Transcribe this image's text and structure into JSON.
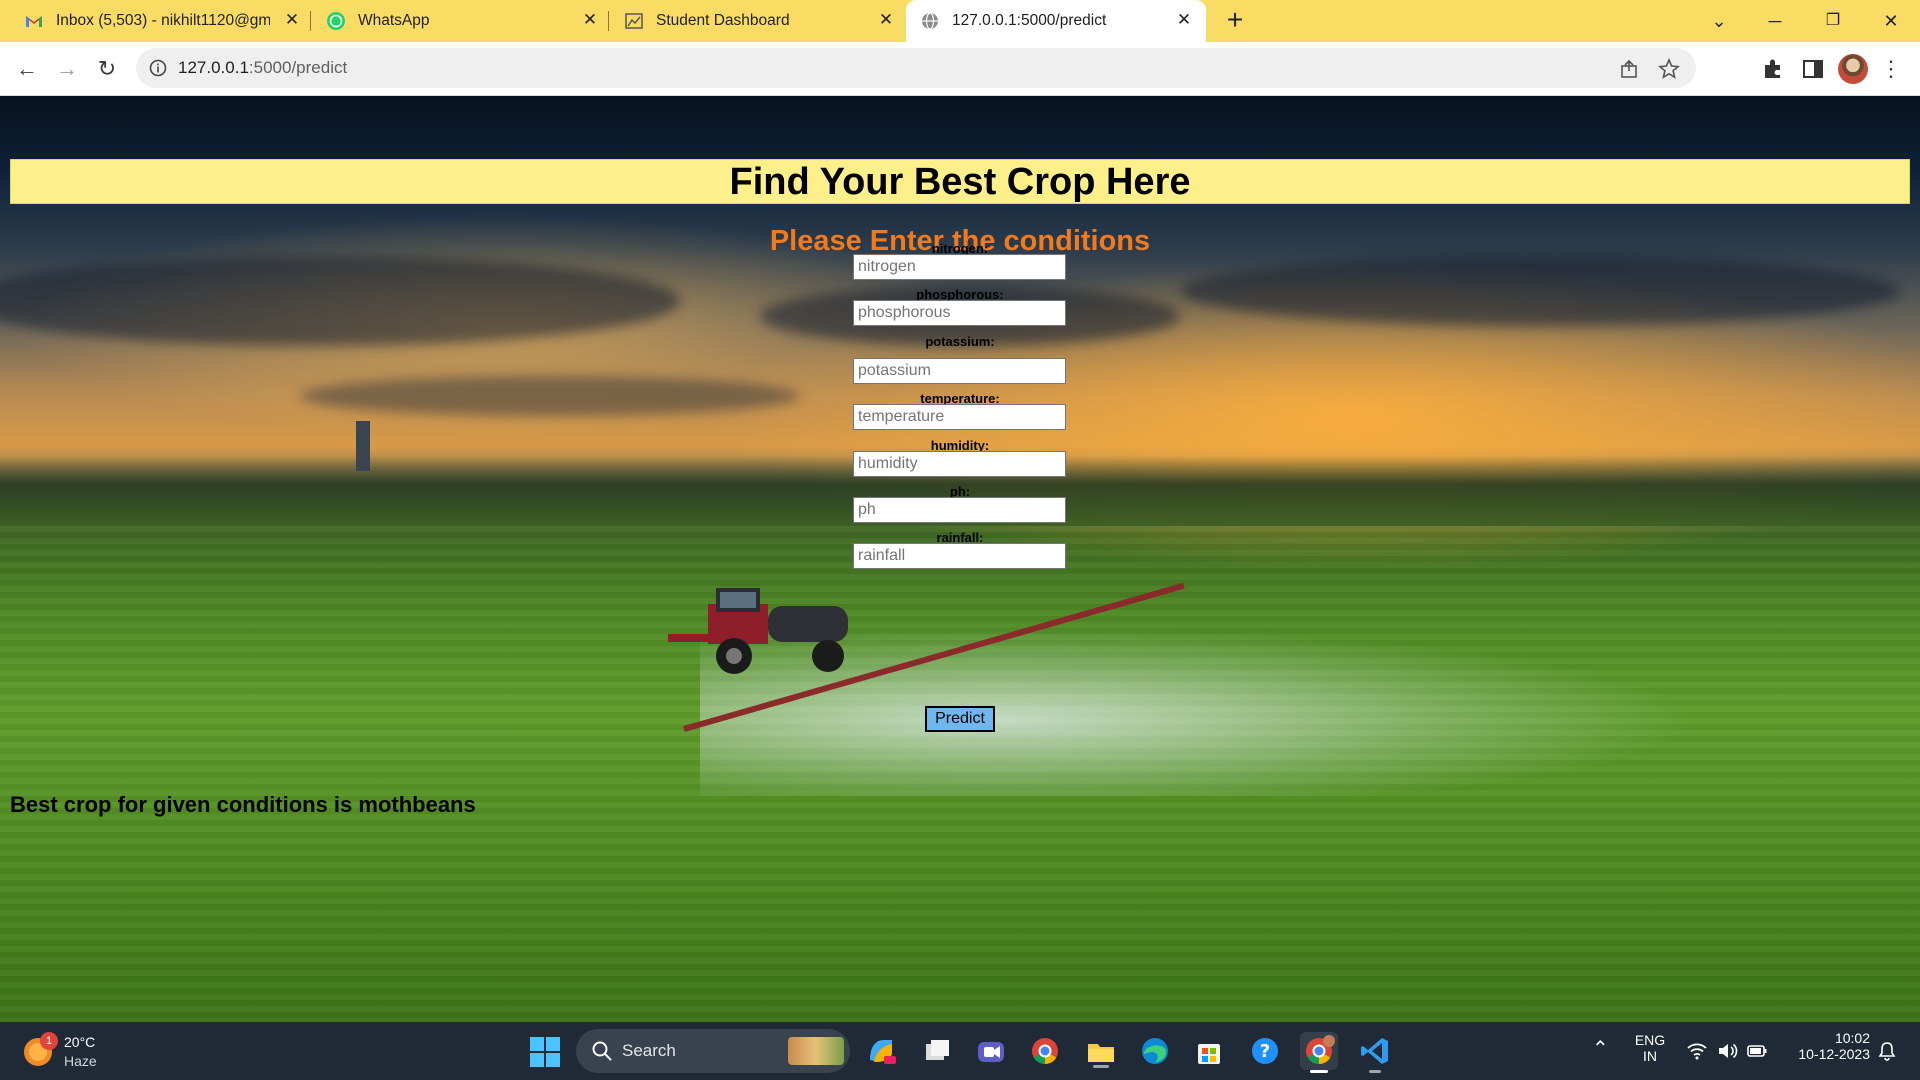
{
  "browser": {
    "tabs": [
      {
        "title": "Inbox (5,503) - nikhilt1120@gma",
        "icon": "gmail-icon",
        "active": false
      },
      {
        "title": "WhatsApp",
        "icon": "whatsapp-icon",
        "active": false
      },
      {
        "title": "Student Dashboard",
        "icon": "dashboard-icon",
        "active": false
      },
      {
        "title": "127.0.0.1:5000/predict",
        "icon": "globe-icon",
        "active": true
      }
    ],
    "url_host": "127.0.0.1",
    "url_rest": ":5000/predict"
  },
  "page": {
    "heading": "Find Your Best Crop Here",
    "subheading": "Please Enter the conditions",
    "fields": [
      {
        "label": "nitrogen:",
        "placeholder": "nitrogen"
      },
      {
        "label": "phosphorous:",
        "placeholder": "phosphorous"
      },
      {
        "label": "potassium:",
        "placeholder": "potassium"
      },
      {
        "label": "temperature:",
        "placeholder": "temperature"
      },
      {
        "label": "humidity:",
        "placeholder": "humidity"
      },
      {
        "label": "ph:",
        "placeholder": "ph"
      },
      {
        "label": "rainfall:",
        "placeholder": "rainfall"
      }
    ],
    "submit_label": "Predict",
    "result": "Best crop for given conditions is mothbeans"
  },
  "taskbar": {
    "weather_temp": "20°C",
    "weather_cond": "Haze",
    "weather_badge": "1",
    "search_label": "Search",
    "lang_top": "ENG",
    "lang_bottom": "IN",
    "time": "10:02",
    "date": "10-12-2023"
  },
  "colors": {
    "tabstrip": "#fadc64",
    "banner": "#fdf08a",
    "subheading": "#f07a1e",
    "predict_button": "#6fb8ee",
    "taskbar": "#1f2a36"
  }
}
